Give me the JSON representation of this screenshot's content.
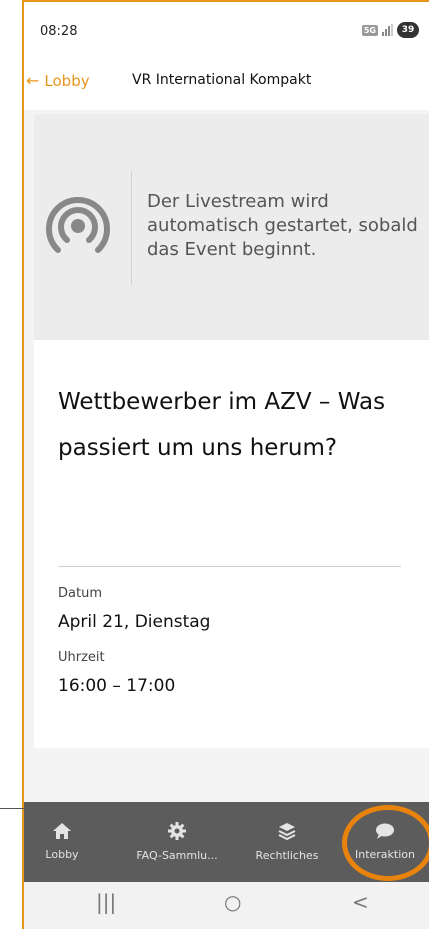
{
  "status_bar": {
    "time": "08:28",
    "network_badge": "5G",
    "battery": "39"
  },
  "header": {
    "back_label": "Lobby",
    "title": "VR International Kompakt"
  },
  "livestream": {
    "icon": "broadcast-icon",
    "message": "Der Livestream wird automatisch gestartet, sobald das Event beginnt."
  },
  "session": {
    "title": "Wettbewerber im AZV – Was passiert um uns herum?",
    "date_label": "Datum",
    "date_value": "April 21, Dienstag",
    "time_label": "Uhrzeit",
    "time_value": "16:00 – 17:00"
  },
  "bottom_nav": {
    "items": [
      {
        "label": "Lobby",
        "icon": "home-icon"
      },
      {
        "label": "FAQ-Sammlu...",
        "icon": "gear-icon"
      },
      {
        "label": "Rechtliches",
        "icon": "layers-icon"
      },
      {
        "label": "Interaktion",
        "icon": "chat-bubble-icon"
      }
    ]
  },
  "system_nav": {
    "recents": "|||",
    "home": "○",
    "back": "<"
  },
  "colors": {
    "accent": "#e8961e",
    "highlight_ring": "#e8830e",
    "bottom_nav_bg": "#5c5c5c"
  }
}
